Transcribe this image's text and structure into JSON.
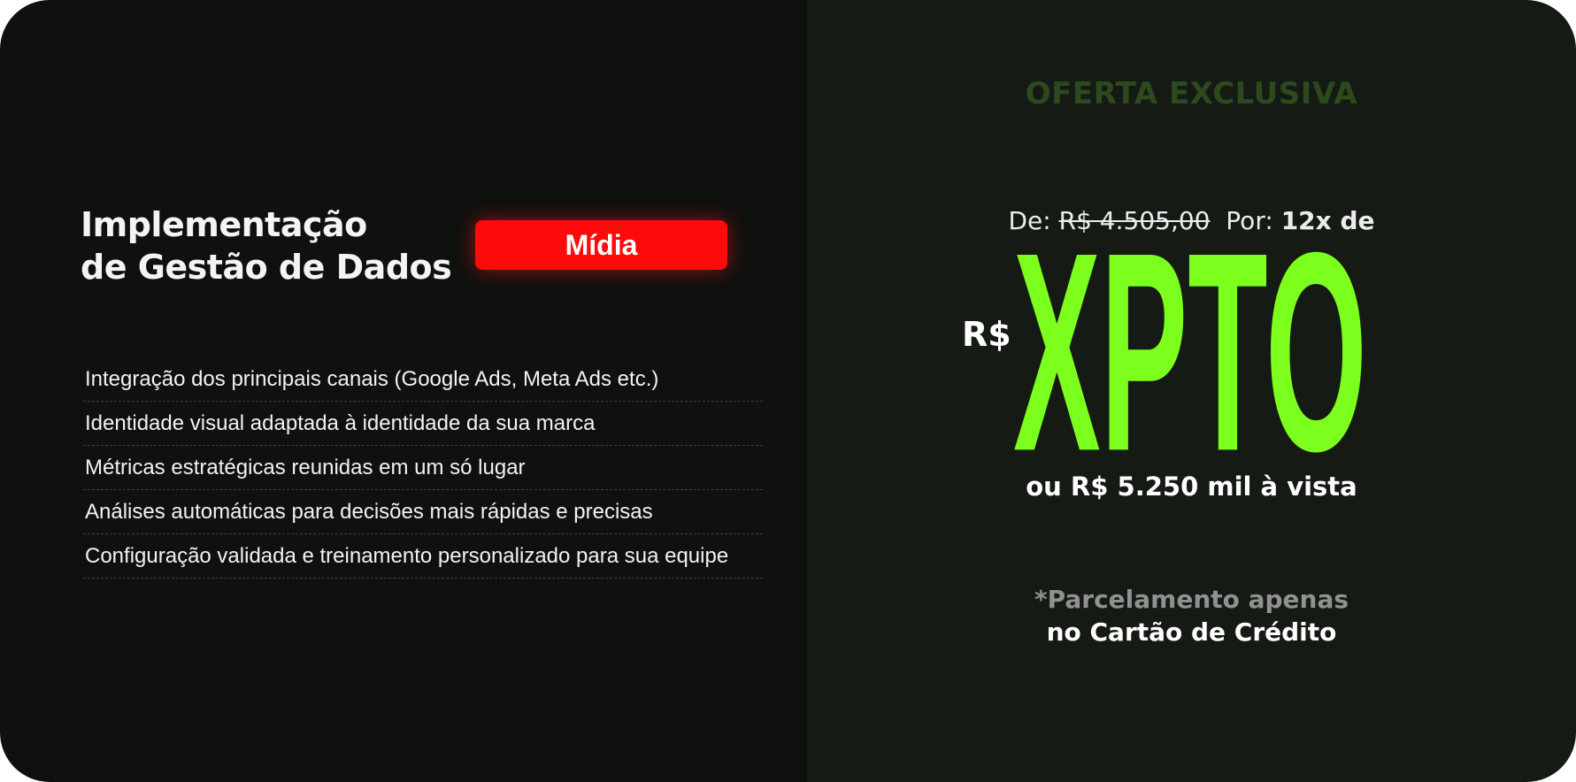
{
  "product": {
    "title_line1": "Implementação",
    "title_line2": "de Gestão de Dados",
    "badge": "Mídia"
  },
  "features": [
    "Integração dos principais canais (Google Ads, Meta Ads etc.)",
    "Identidade visual adaptada à identidade da sua marca",
    "Métricas estratégicas reunidas em um só lugar",
    "Análises automáticas para decisões mais rápidas e precisas",
    "Configuração validada e treinamento personalizado para sua equipe"
  ],
  "offer": {
    "label": "OFERTA EXCLUSIVA",
    "from_label": "De:",
    "old_price": "R$ 4.505,00",
    "by_label": "Por:",
    "installments": "12x de",
    "currency": "R$",
    "price_value": "XPTO",
    "cash_price": "ou R$ 5.250 mil à vista",
    "note_line1": "*Parcelamento apenas",
    "note_line2": "no Cartão de Crédito"
  },
  "colors": {
    "left_bg": "#0f110f",
    "right_bg": "#161a15",
    "badge": "#ff0a0a",
    "accent_green": "#7dff1e",
    "offer_label": "#2d4a1c"
  }
}
